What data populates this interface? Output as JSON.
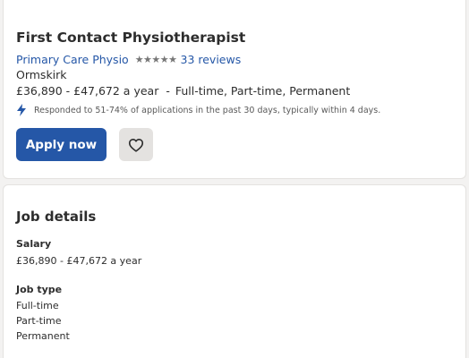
{
  "job": {
    "title": "First Contact Physiotherapist",
    "company": "Primary Care Physio",
    "rating_stars": "★★★★★",
    "reviews": "33 reviews",
    "location": "Ormskirk",
    "salary": "£36,890 - £47,672 a year",
    "separator": "-",
    "job_types_inline": "Full-time, Part-time, Permanent",
    "responded": "Responded to 51-74% of applications in the past 30 days, typically within 4 days."
  },
  "actions": {
    "apply_label": "Apply now",
    "save_icon": "heart-icon"
  },
  "details": {
    "heading": "Job details",
    "salary_label": "Salary",
    "salary_value": "£36,890 - £47,672 a year",
    "job_type_label": "Job type",
    "job_types": [
      "Full-time",
      "Part-time",
      "Permanent"
    ]
  },
  "colors": {
    "brand_blue": "#2557a7",
    "text": "#2d2d2d",
    "muted": "#595959",
    "save_bg": "#e4e2e0"
  }
}
